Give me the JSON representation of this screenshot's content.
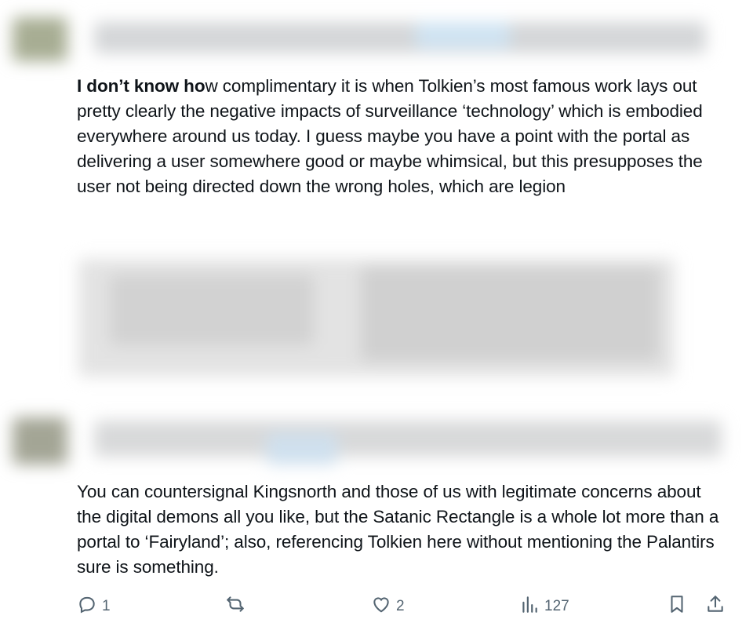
{
  "reply1": {
    "bold_lead": "I don’t know ho",
    "text": "w complimentary it is when Tolkien’s most famous work lays out pretty clearly the negative impacts of surveillance ‘technology’ which is embodied everywhere around us today.  I guess maybe you have a point with the portal as delivering a user somewhere good or maybe whimsical, but this presupposes the user not being directed down the wrong holes, which are legion"
  },
  "reply2": {
    "text": "You can countersignal Kingsnorth and those of us with legitimate concerns about the digital demons all you like, but the Satanic Rectangle is a whole lot more than a portal to ‘Fairyland’; also, referencing Tolkien here without mentioning the Palantirs sure is something."
  },
  "actions": {
    "reply_count": "1",
    "repost_count": "",
    "like_count": "2",
    "views_count": "127"
  },
  "icons": {
    "reply": "reply-icon",
    "repost": "repost-icon",
    "like": "heart-icon",
    "views": "views-icon",
    "bookmark": "bookmark-icon",
    "share": "share-icon"
  },
  "colors": {
    "text": "#0f1419",
    "secondary": "#536471"
  }
}
